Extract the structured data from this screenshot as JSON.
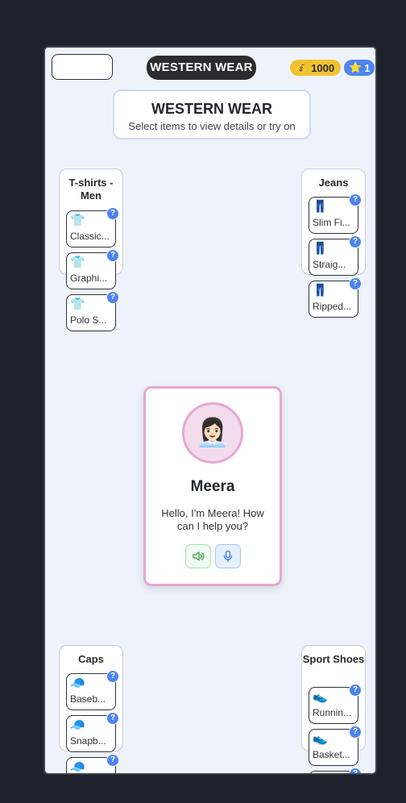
{
  "header": {
    "title": "WESTERN WEAR",
    "coins": "1000",
    "stars": "1"
  },
  "hero": {
    "title": "WESTERN WEAR",
    "subtitle": "Select items to view details or try on"
  },
  "categories": [
    {
      "title": "T-shirts - Men",
      "items": [
        {
          "label": "Classic...",
          "icon": "t-shirt-icon"
        },
        {
          "label": "Graphi...",
          "icon": "t-shirt-icon"
        },
        {
          "label": "Polo S...",
          "icon": "t-shirt-icon"
        }
      ]
    },
    {
      "title": "Jeans",
      "items": [
        {
          "label": "Slim Fi...",
          "icon": "jeans-icon"
        },
        {
          "label": "Straig...",
          "icon": "jeans-icon"
        },
        {
          "label": "Ripped...",
          "icon": "jeans-icon"
        }
      ]
    },
    {
      "title": "Caps",
      "items": [
        {
          "label": "Baseb...",
          "icon": "cap-icon"
        },
        {
          "label": "Snapb...",
          "icon": "cap-icon"
        },
        {
          "label": "",
          "icon": "cap-icon"
        }
      ]
    },
    {
      "title": "Sport Shoes",
      "items": [
        {
          "label": "Runnin...",
          "icon": "sneaker-icon"
        },
        {
          "label": "Basket...",
          "icon": "sneaker-icon"
        },
        {
          "label": "",
          "icon": "sneaker-icon"
        }
      ]
    }
  ],
  "assistant": {
    "name": "Meera",
    "message": "Hello, I'm Meera! How can I help you?"
  },
  "help_badge": "?"
}
